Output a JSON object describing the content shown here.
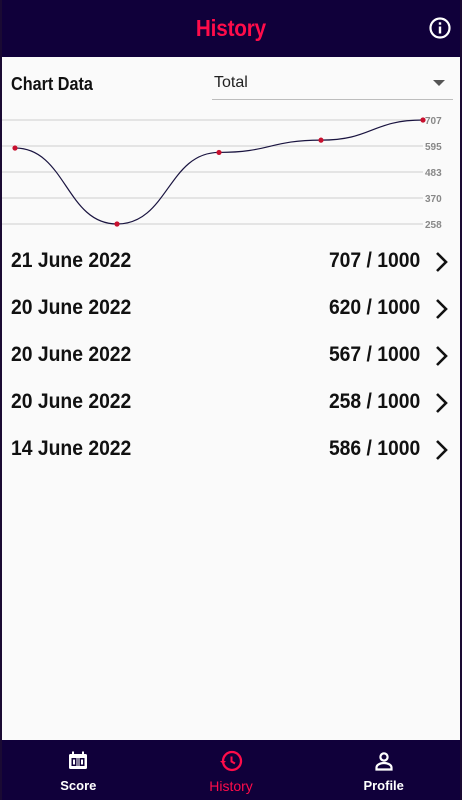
{
  "header": {
    "title": "History",
    "info_icon": "info-icon"
  },
  "chart_section": {
    "label": "Chart Data",
    "select_value": "Total"
  },
  "chart_data": {
    "type": "line",
    "x": [
      "14 June 2022",
      "20 June 2022",
      "20 June 2022",
      "20 June 2022",
      "21 June 2022"
    ],
    "values": [
      586,
      258,
      567,
      620,
      707
    ],
    "ytick_labels": [
      "707",
      "595",
      "483",
      "370",
      "258"
    ],
    "ylim": [
      258,
      707
    ],
    "grid": true,
    "colors": {
      "line": "#1a1440",
      "point": "#c8102e",
      "grid": "#cfcfcf"
    }
  },
  "history": [
    {
      "date": "21 June 2022",
      "score": "707 / 1000"
    },
    {
      "date": "20 June 2022",
      "score": "620 / 1000"
    },
    {
      "date": "20 June 2022",
      "score": "567 / 1000"
    },
    {
      "date": "20 June 2022",
      "score": "258 / 1000"
    },
    {
      "date": "14 June 2022",
      "score": "586 / 1000"
    }
  ],
  "nav": {
    "items": [
      {
        "label": "Score",
        "icon": "scoreboard-icon",
        "active": false
      },
      {
        "label": "History",
        "icon": "history-icon",
        "active": true
      },
      {
        "label": "Profile",
        "icon": "person-icon",
        "active": false
      }
    ]
  },
  "colors": {
    "header_bg": "#10003a",
    "accent": "#ff0c4a",
    "page_bg": "#fafafa"
  }
}
